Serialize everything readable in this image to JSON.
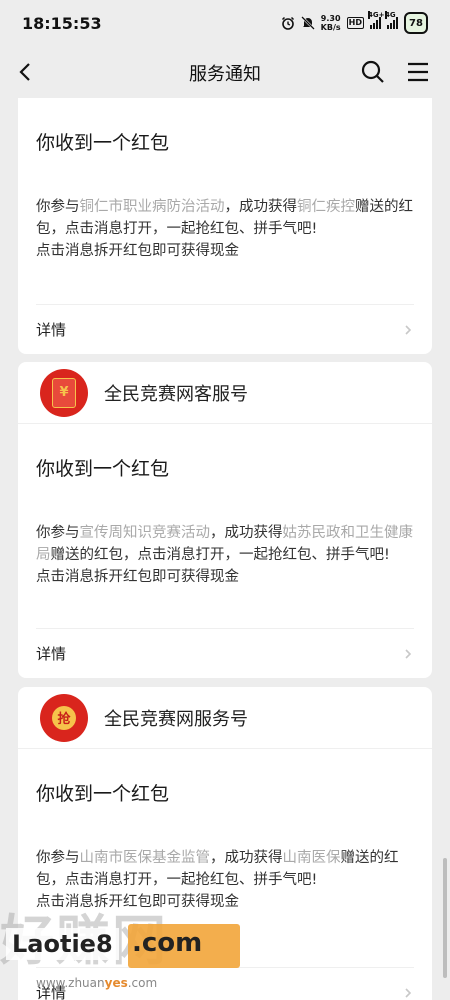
{
  "status": {
    "time": "18:15:53",
    "net_speed_value": "9.30",
    "net_speed_unit": "KB/s",
    "hd_label": "HD",
    "signal1_label": "4G+",
    "signal2_label": "4G",
    "battery": "78"
  },
  "nav": {
    "title": "服务通知"
  },
  "cards": [
    {
      "sender": "",
      "title": "你收到一个红包",
      "pre1": "你参与",
      "activity": "铜仁市职业病防治活动",
      "mid": "，成功获得",
      "org": "铜仁疾控",
      "post": "赠送的红包，点击消息打开，一起抢红包、拼手气吧!",
      "line2": "点击消息拆开红包即可获得现金",
      "details": "详情"
    },
    {
      "sender": "全民竞赛网客服号",
      "avatar_glyph": "¥",
      "title": "你收到一个红包",
      "pre1": "你参与",
      "activity": "宣传周知识竞赛活动",
      "mid": "，成功获得",
      "org": "姑苏民政和卫生健康局",
      "post": "赠送的红包，点击消息打开，一起抢红包、拼手气吧!",
      "line2": "点击消息拆开红包即可获得现金",
      "details": "详情"
    },
    {
      "sender": "全民竞赛网服务号",
      "avatar_glyph": "抢",
      "title": "你收到一个红包",
      "pre1": "你参与",
      "activity": "山南市医保基金监管",
      "mid": "，成功获得",
      "org": "山南医保",
      "post": "赠送的红包，点击消息打开，一起抢红包、拼手气吧!",
      "line2": "点击消息拆开红包即可获得现金",
      "details": "详情"
    }
  ],
  "watermark": {
    "big": "好赚网",
    "chip": "Laotie8",
    "domain": ".com",
    "url_pre": "www.zhuan",
    "url_mid": "yes",
    "url_post": ".com"
  },
  "colors": {
    "red_packet": "#d9251d",
    "highlight_gray": "#a9a9a9",
    "background": "#ededed"
  }
}
